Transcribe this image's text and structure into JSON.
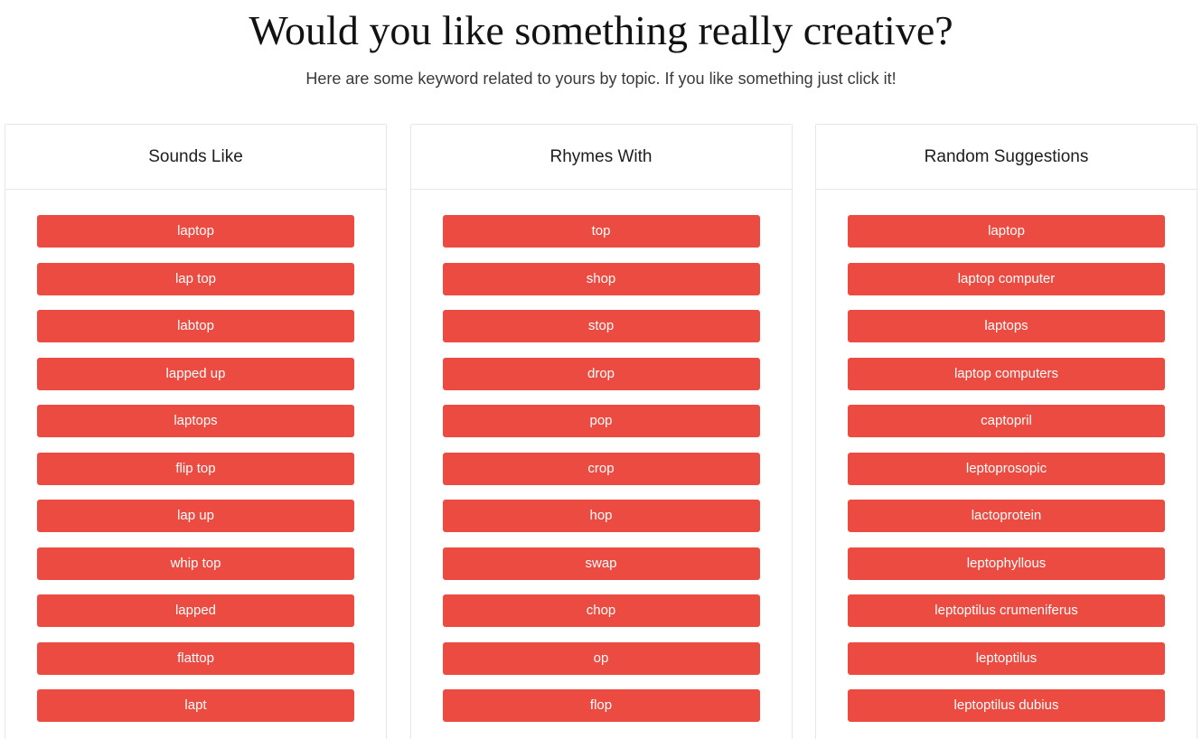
{
  "header": {
    "title": "Would you like something really creative?",
    "subtitle": "Here are some keyword related to yours by topic. If you like something just click it!"
  },
  "theme": {
    "button_color": "#ec4b41",
    "button_text_color": "#ffffff",
    "card_border_color": "#e6e6e6",
    "background_color": "#ffffff",
    "title_color": "#121212"
  },
  "columns": [
    {
      "id": "sounds-like",
      "title": "Sounds Like",
      "items": [
        "laptop",
        "lap top",
        "labtop",
        "lapped up",
        "laptops",
        "flip top",
        "lap up",
        "whip top",
        "lapped",
        "flattop",
        "lapt"
      ]
    },
    {
      "id": "rhymes-with",
      "title": "Rhymes With",
      "items": [
        "top",
        "shop",
        "stop",
        "drop",
        "pop",
        "crop",
        "hop",
        "swap",
        "chop",
        "op",
        "flop"
      ]
    },
    {
      "id": "random-suggestions",
      "title": "Random Suggestions",
      "items": [
        "laptop",
        "laptop computer",
        "laptops",
        "laptop computers",
        "captopril",
        "leptoprosopic",
        "lactoprotein",
        "leptophyllous",
        "leptoptilus crumeniferus",
        "leptoptilus",
        "leptoptilus dubius"
      ]
    }
  ]
}
